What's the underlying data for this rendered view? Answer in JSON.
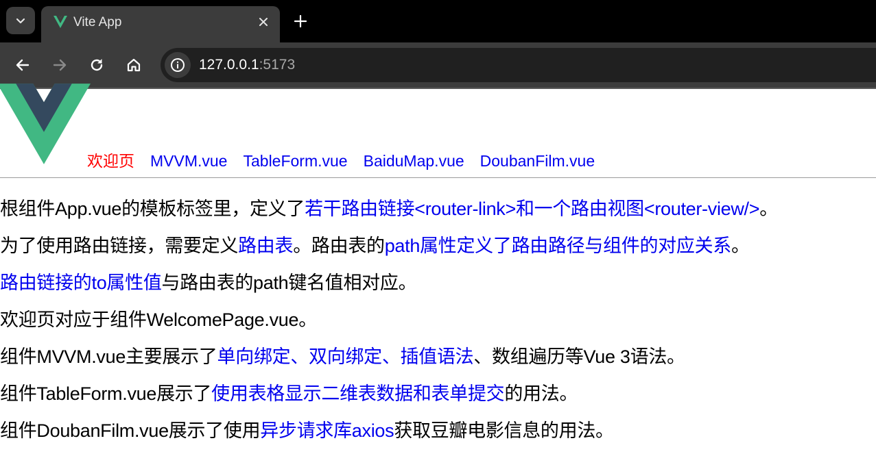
{
  "browser": {
    "tab_title": "Vite App",
    "url_host": "127.0.0.1",
    "url_port": ":5173",
    "icons": [
      "tab-search-icon",
      "vite-favicon",
      "close-icon",
      "plus-icon",
      "back-arrow-icon",
      "forward-arrow-icon",
      "reload-icon",
      "home-icon",
      "info-icon"
    ]
  },
  "nav": {
    "links": [
      "欢迎页",
      "MVVM.vue",
      "TableForm.vue",
      "BaiduMap.vue",
      "DoubanFilm.vue"
    ],
    "active_color": "#ff0000",
    "link_color": "#0000ee"
  },
  "content": {
    "p1": [
      "根组件App.vue的模板标签里，定义了",
      "若干路由链接<router-link>和一个路由视图<router-view/>",
      "。"
    ],
    "p2": [
      "为了使用路由链接，需要定义",
      "路由表",
      "。路由表的",
      "path属性定义了路由路径与组件的对应关系",
      "。"
    ],
    "p3": [
      "路由链接的to属性值",
      "与路由表的path键名值相对应。"
    ],
    "p4": [
      "欢迎页对应于组件WelcomePage.vue。"
    ],
    "p5": [
      "组件MVVM.vue主要展示了",
      "单向绑定、双向绑定、插值语法",
      "、数组遍历等Vue 3语法。"
    ],
    "p6": [
      "组件TableForm.vue展示了",
      "使用表格显示二维表数据和表单提交",
      "的用法。"
    ],
    "p7": [
      "组件DoubanFilm.vue展示了使用",
      "异步请求库axios",
      "获取豆瓣电影信息的用法。"
    ]
  },
  "colors": {
    "highlight": "#0000ee",
    "tabbar_bg": "#000000",
    "toolbar_bg": "#3c3c3c",
    "vue_green": "#41b883",
    "vue_dark": "#34495e"
  }
}
